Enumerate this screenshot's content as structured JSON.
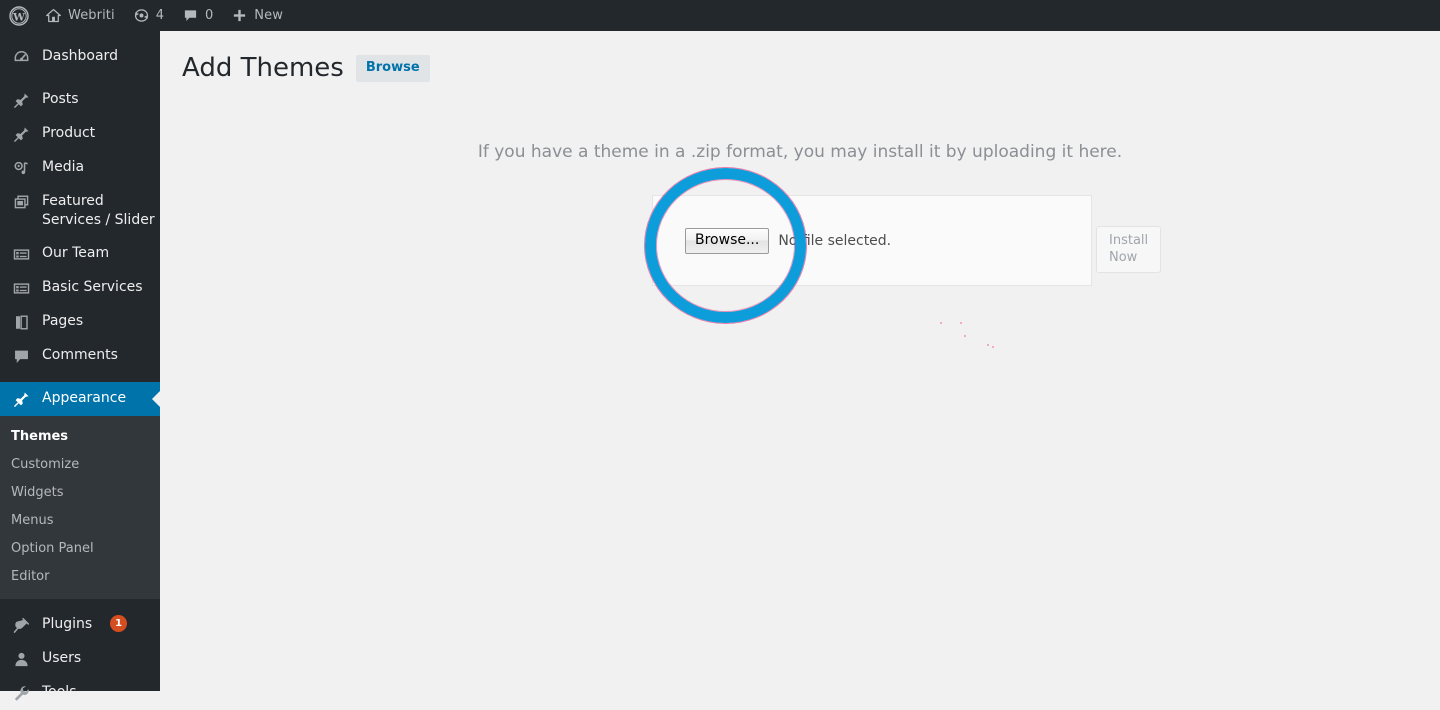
{
  "adminbar": {
    "items": [
      {
        "name": "wordpress-logo",
        "icon": "wordpress-icon",
        "label": ""
      },
      {
        "name": "site-name",
        "icon": "home-icon",
        "label": "Webriti"
      },
      {
        "name": "updates",
        "icon": "updates-icon",
        "label": "4"
      },
      {
        "name": "comments",
        "icon": "comment-bubble-icon",
        "label": "0"
      },
      {
        "name": "new-content",
        "icon": "plus-icon",
        "label": "New"
      }
    ]
  },
  "sidebar": {
    "items": [
      {
        "label": "Dashboard",
        "icon": "dashboard-icon",
        "current": false,
        "badge": ""
      },
      {
        "label": "Posts",
        "icon": "pin-icon",
        "current": false,
        "badge": ""
      },
      {
        "label": "Product",
        "icon": "pin-icon",
        "current": false,
        "badge": ""
      },
      {
        "label": "Media",
        "icon": "media-icon",
        "current": false,
        "badge": ""
      },
      {
        "label": "Featured Services / Slider",
        "icon": "pages-stack-icon",
        "current": false,
        "badge": ""
      },
      {
        "label": "Our Team",
        "icon": "form-icon",
        "current": false,
        "badge": ""
      },
      {
        "label": "Basic Services",
        "icon": "form-icon",
        "current": false,
        "badge": ""
      },
      {
        "label": "Pages",
        "icon": "page-icon",
        "current": false,
        "badge": ""
      },
      {
        "label": "Comments",
        "icon": "comment-bubble-icon",
        "current": false,
        "badge": ""
      },
      {
        "label": "Appearance",
        "icon": "brush-icon",
        "current": true,
        "badge": ""
      },
      {
        "label": "Plugins",
        "icon": "plug-icon",
        "current": false,
        "badge": "1"
      },
      {
        "label": "Users",
        "icon": "user-icon",
        "current": false,
        "badge": ""
      },
      {
        "label": "Tools",
        "icon": "tools-icon",
        "current": false,
        "badge": ""
      }
    ],
    "submenu": [
      {
        "label": "Themes",
        "current": true
      },
      {
        "label": "Customize",
        "current": false
      },
      {
        "label": "Widgets",
        "current": false
      },
      {
        "label": "Menus",
        "current": false
      },
      {
        "label": "Option Panel",
        "current": false
      },
      {
        "label": "Editor",
        "current": false
      }
    ]
  },
  "page": {
    "title": "Add Themes",
    "browse_tab": "Browse"
  },
  "upload": {
    "hint": "If you have a theme in a .zip format, you may install it by uploading it here.",
    "browse_button": "Browse...",
    "file_status": "No file selected.",
    "install_button": "Install Now"
  },
  "colors": {
    "accent": "#0073aa",
    "highlight_ring": "#0d9ddb",
    "highlight_ring_edge": "#e6146e",
    "admin_bar_bg": "#23282d",
    "sidebar_bg": "#23282d",
    "submenu_bg": "#32373c",
    "badge_bg": "#d54e21",
    "content_bg": "#f1f1f1"
  }
}
